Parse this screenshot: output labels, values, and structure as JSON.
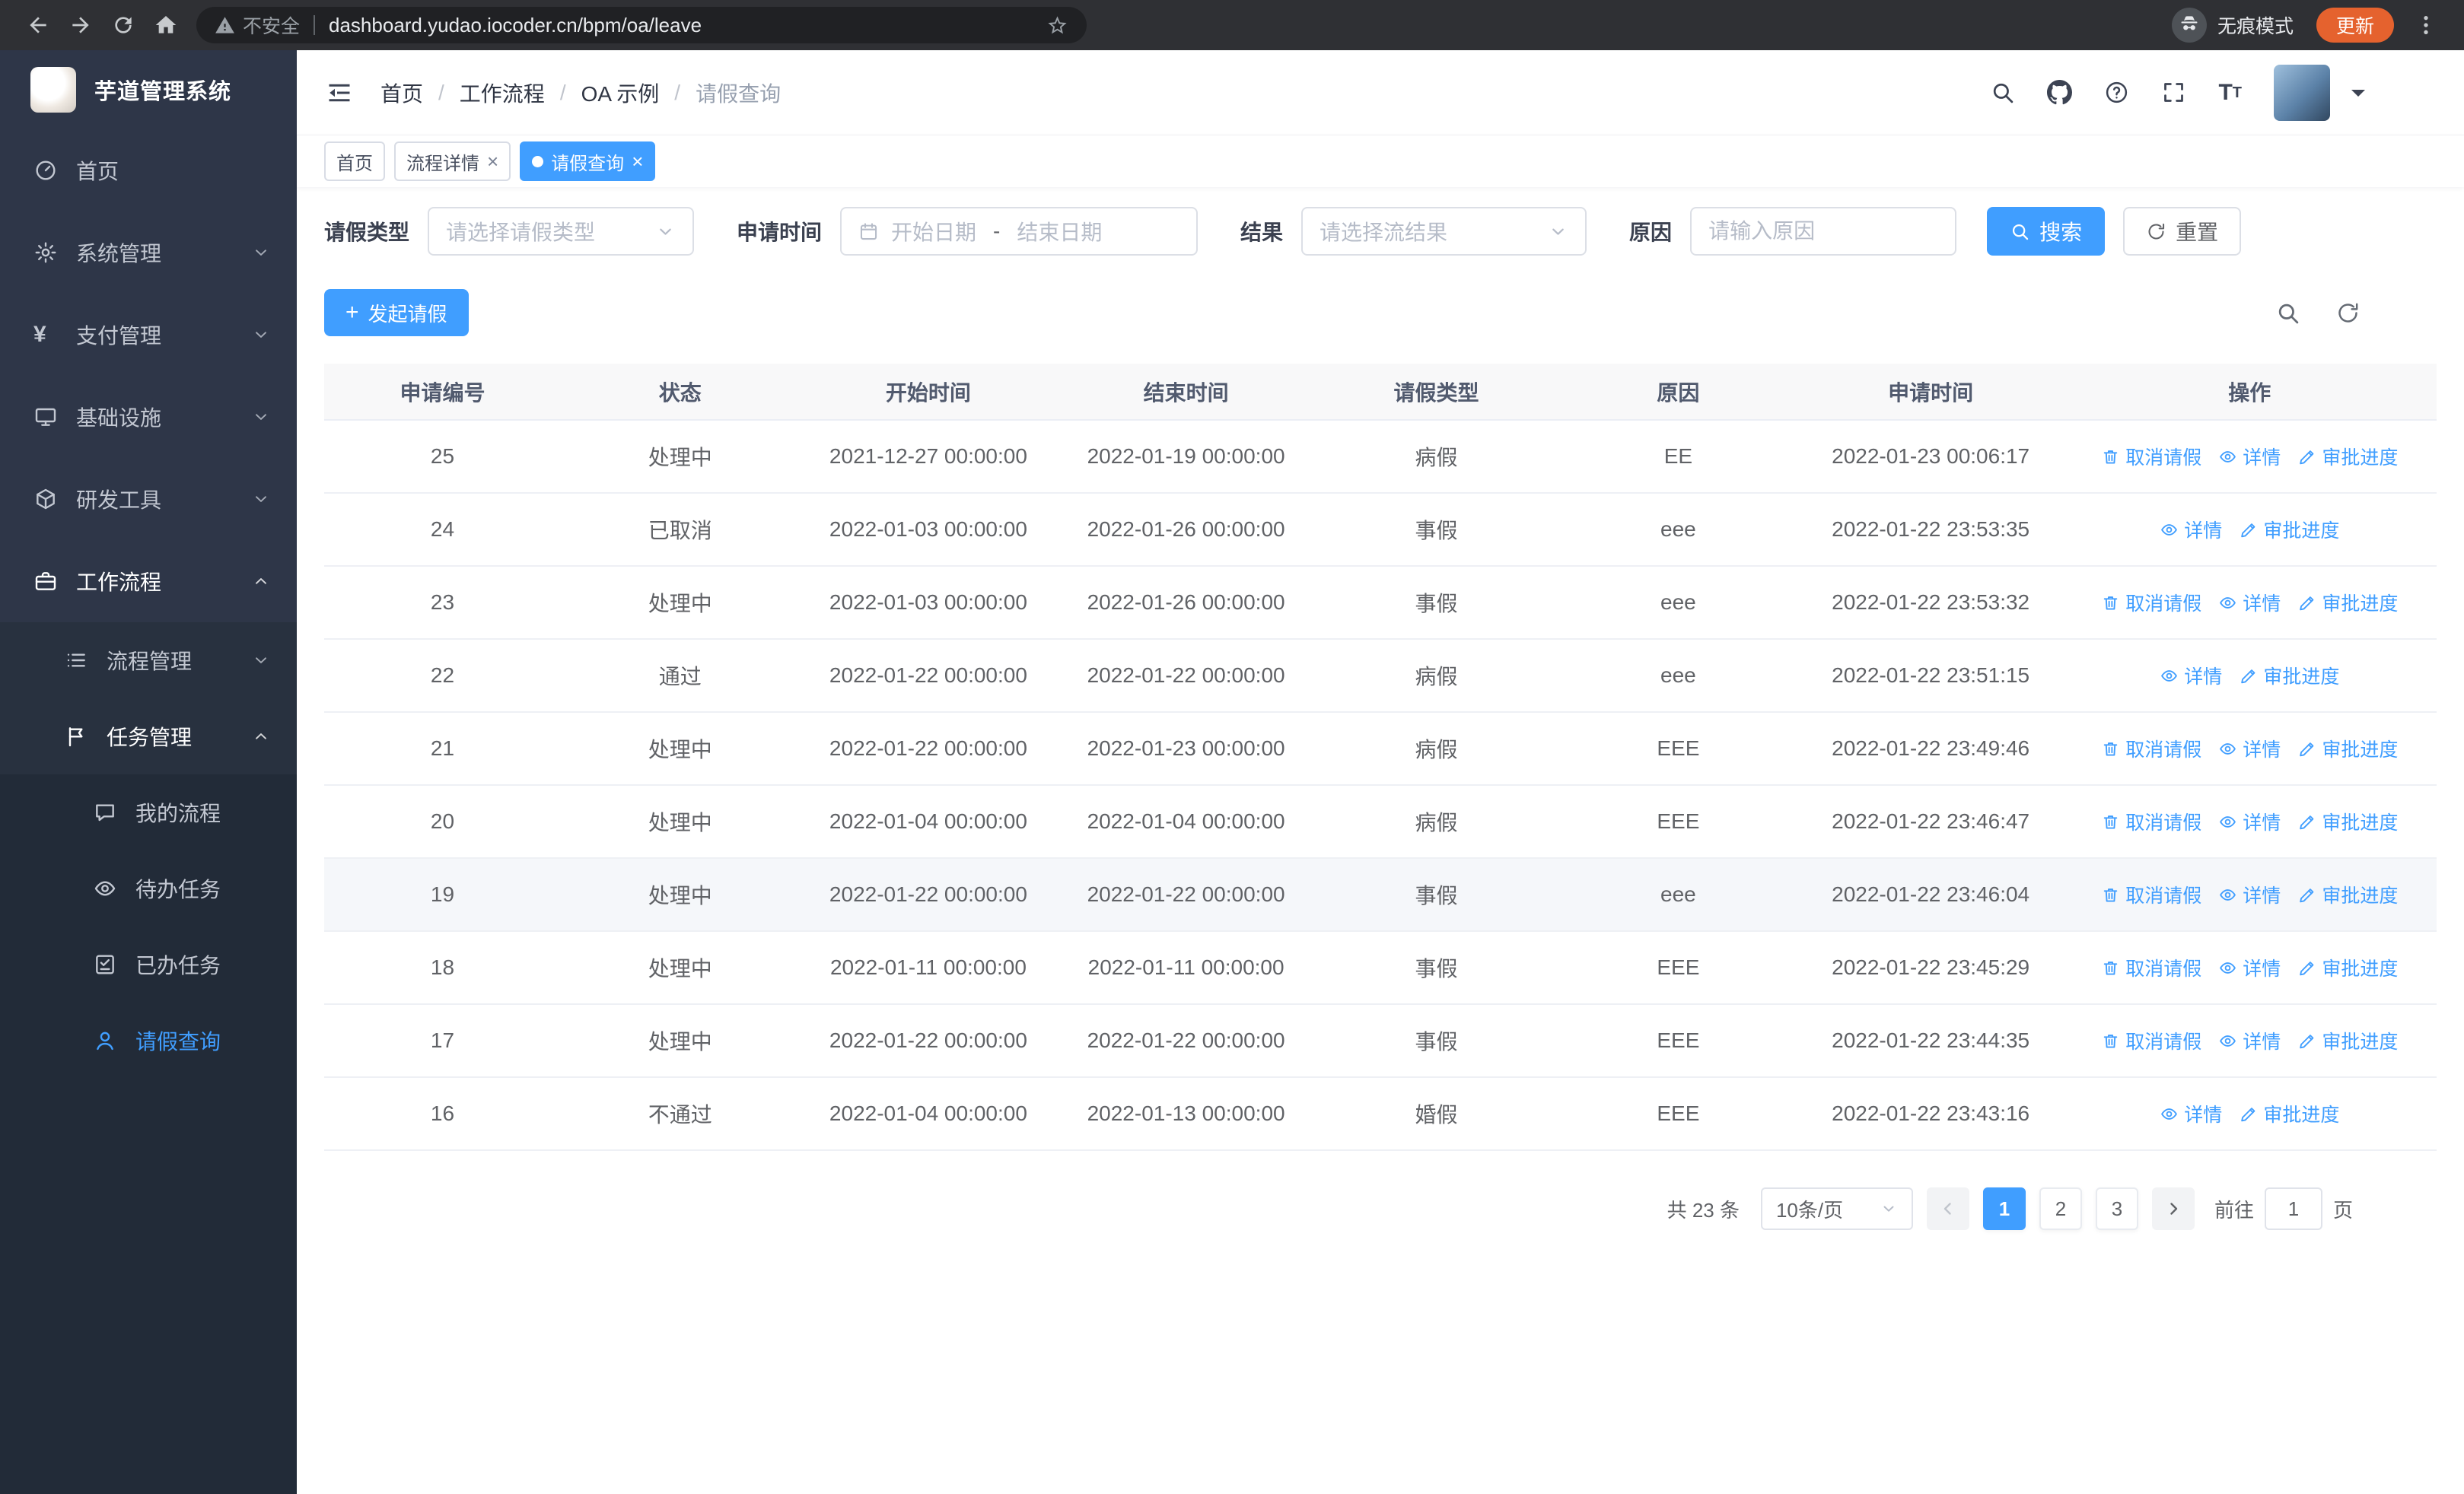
{
  "colors": {
    "accent": "#409eff",
    "update_badge": "#e5622e",
    "sidebar_bg": "#2e3648"
  },
  "browser": {
    "security_label": "不安全",
    "url": "dashboard.yudao.iocoder.cn/bpm/oa/leave",
    "incognito_label": "无痕模式",
    "update_label": "更新"
  },
  "sidebar": {
    "logo_title": "芋道管理系统",
    "menu": [
      {
        "key": "home",
        "label": "首页",
        "icon": "dashboard-icon",
        "level": 1
      },
      {
        "key": "system",
        "label": "系统管理",
        "icon": "gear-icon",
        "level": 1,
        "chevron": "down"
      },
      {
        "key": "payment",
        "label": "支付管理",
        "icon": "payment-icon",
        "level": 1,
        "chevron": "down"
      },
      {
        "key": "infrastructure",
        "label": "基础设施",
        "icon": "infrastructure-icon",
        "level": 1,
        "chevron": "down"
      },
      {
        "key": "devtools",
        "label": "研发工具",
        "icon": "devtools-icon",
        "level": 1,
        "chevron": "down"
      },
      {
        "key": "workflow",
        "label": "工作流程",
        "icon": "workflow-icon",
        "level": 1,
        "chevron": "up",
        "emphasis": true
      },
      {
        "key": "process-management",
        "label": "流程管理",
        "icon": "process-icon",
        "level": 2,
        "chevron": "down"
      },
      {
        "key": "task-management",
        "label": "任务管理",
        "icon": "task-icon",
        "level": 2,
        "chevron": "up",
        "emphasis": true
      },
      {
        "key": "my-process",
        "label": "我的流程",
        "icon": "my-process-icon",
        "level": 3
      },
      {
        "key": "todo-tasks",
        "label": "待办任务",
        "icon": "todo-icon",
        "level": 3
      },
      {
        "key": "done-tasks",
        "label": "已办任务",
        "icon": "done-icon",
        "level": 3
      },
      {
        "key": "leave-query",
        "label": "请假查询",
        "icon": "leave-icon",
        "level": 3,
        "active": true
      }
    ]
  },
  "header": {
    "breadcrumb": [
      {
        "label": "首页"
      },
      {
        "label": "工作流程"
      },
      {
        "label": "OA 示例"
      },
      {
        "label": "请假查询",
        "current": true
      }
    ]
  },
  "tabs": [
    {
      "label": "首页"
    },
    {
      "label": "流程详情",
      "closable": true
    },
    {
      "label": "请假查询",
      "closable": true,
      "active": true
    }
  ],
  "filters": {
    "leave_type_label": "请假类型",
    "leave_type_placeholder": "请选择请假类型",
    "apply_time_label": "申请时间",
    "start_date_placeholder": "开始日期",
    "range_separator": "-",
    "end_date_placeholder": "结束日期",
    "result_label": "结果",
    "result_placeholder": "请选择流结果",
    "reason_label": "原因",
    "reason_placeholder": "请输入原因",
    "search_label": "搜索",
    "reset_label": "重置"
  },
  "toolbar": {
    "create_label": "发起请假"
  },
  "table": {
    "columns": [
      "申请编号",
      "状态",
      "开始时间",
      "结束时间",
      "请假类型",
      "原因",
      "申请时间",
      "操作"
    ],
    "action_labels": {
      "cancel": "取消请假",
      "detail": "详情",
      "progress": "审批进度"
    },
    "rows": [
      {
        "id": "25",
        "status": "处理中",
        "start": "2021-12-27 00:00:00",
        "end": "2022-01-19 00:00:00",
        "type": "病假",
        "reason": "EE",
        "apply_time": "2022-01-23 00:06:17",
        "cancellable": true
      },
      {
        "id": "24",
        "status": "已取消",
        "start": "2022-01-03 00:00:00",
        "end": "2022-01-26 00:00:00",
        "type": "事假",
        "reason": "eee",
        "apply_time": "2022-01-22 23:53:35",
        "cancellable": false
      },
      {
        "id": "23",
        "status": "处理中",
        "start": "2022-01-03 00:00:00",
        "end": "2022-01-26 00:00:00",
        "type": "事假",
        "reason": "eee",
        "apply_time": "2022-01-22 23:53:32",
        "cancellable": true
      },
      {
        "id": "22",
        "status": "通过",
        "start": "2022-01-22 00:00:00",
        "end": "2022-01-22 00:00:00",
        "type": "病假",
        "reason": "eee",
        "apply_time": "2022-01-22 23:51:15",
        "cancellable": false
      },
      {
        "id": "21",
        "status": "处理中",
        "start": "2022-01-22 00:00:00",
        "end": "2022-01-23 00:00:00",
        "type": "病假",
        "reason": "EEE",
        "apply_time": "2022-01-22 23:49:46",
        "cancellable": true
      },
      {
        "id": "20",
        "status": "处理中",
        "start": "2022-01-04 00:00:00",
        "end": "2022-01-04 00:00:00",
        "type": "病假",
        "reason": "EEE",
        "apply_time": "2022-01-22 23:46:47",
        "cancellable": true
      },
      {
        "id": "19",
        "status": "处理中",
        "start": "2022-01-22 00:00:00",
        "end": "2022-01-22 00:00:00",
        "type": "事假",
        "reason": "eee",
        "apply_time": "2022-01-22 23:46:04",
        "cancellable": true,
        "highlighted": true
      },
      {
        "id": "18",
        "status": "处理中",
        "start": "2022-01-11 00:00:00",
        "end": "2022-01-11 00:00:00",
        "type": "事假",
        "reason": "EEE",
        "apply_time": "2022-01-22 23:45:29",
        "cancellable": true
      },
      {
        "id": "17",
        "status": "处理中",
        "start": "2022-01-22 00:00:00",
        "end": "2022-01-22 00:00:00",
        "type": "事假",
        "reason": "EEE",
        "apply_time": "2022-01-22 23:44:35",
        "cancellable": true
      },
      {
        "id": "16",
        "status": "不通过",
        "start": "2022-01-04 00:00:00",
        "end": "2022-01-13 00:00:00",
        "type": "婚假",
        "reason": "EEE",
        "apply_time": "2022-01-22 23:43:16",
        "cancellable": false
      }
    ]
  },
  "pagination": {
    "total": "共 23 条",
    "page_size": "10条/页",
    "pages": [
      "1",
      "2",
      "3"
    ],
    "active_page": "1",
    "goto_label": "前往",
    "goto_value": "1",
    "page_unit": "页"
  }
}
